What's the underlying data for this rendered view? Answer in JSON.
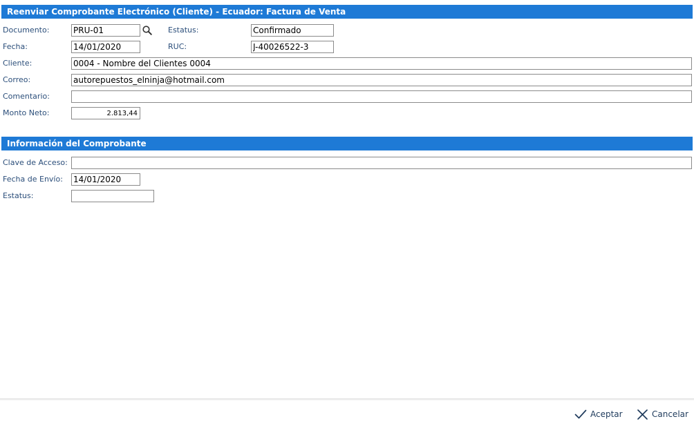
{
  "header": {
    "title": "Reenviar Comprobante Electrónico (Cliente) - Ecuador: Factura de Venta"
  },
  "form": {
    "documento": {
      "label": "Documento:",
      "value": "PRU-01"
    },
    "estatus": {
      "label": "Estatus:",
      "value": "Confirmado"
    },
    "fecha": {
      "label": "Fecha:",
      "value": "14/01/2020"
    },
    "ruc": {
      "label": "RUC:",
      "value": "J-40026522-3"
    },
    "cliente": {
      "label": "Cliente:",
      "value": "0004 - Nombre del Clientes 0004"
    },
    "correo": {
      "label": "Correo:",
      "value": "autorepuestos_elninja@hotmail.com"
    },
    "comentario": {
      "label": "Comentario:",
      "value": ""
    },
    "monto_neto": {
      "label": "Monto Neto:",
      "value": "2.813,44"
    }
  },
  "comprobante": {
    "title": "Información del Comprobante",
    "clave_acceso": {
      "label": "Clave de Acceso:",
      "value": ""
    },
    "fecha_envio": {
      "label": "Fecha de Envío:",
      "value": "14/01/2020"
    },
    "estatus": {
      "label": "Estatus:",
      "value": ""
    }
  },
  "footer": {
    "accept_label": "Aceptar",
    "cancel_label": "Cancelar"
  },
  "colors": {
    "header_bg": "#1e7ad6",
    "label_text": "#2b4e7a"
  },
  "icons": {
    "lookup": "search-icon",
    "accept": "check-icon",
    "cancel": "close-icon"
  }
}
